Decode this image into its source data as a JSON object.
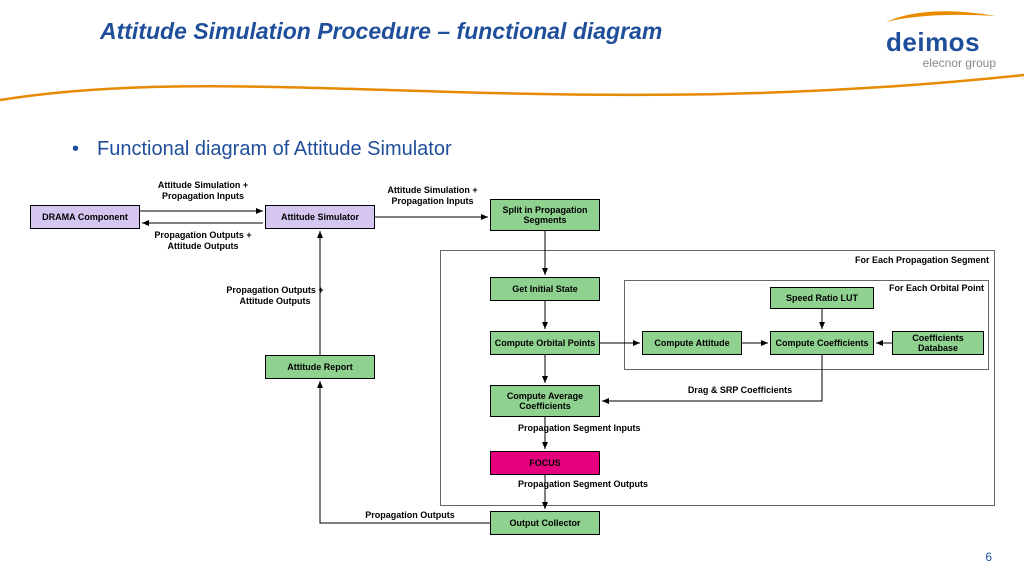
{
  "title": "Attitude Simulation Procedure – functional diagram",
  "logo": {
    "name": "deimos",
    "sub": "elecnor group"
  },
  "bullet": "Functional diagram of Attitude Simulator",
  "page": "6",
  "labels": {
    "l_attSimPropInputs_left": "Attitude Simulation + Propagation Inputs",
    "l_propOut_attOut_left": "Propagation Outputs + Attitude Outputs",
    "l_attSimPropInputs_mid": "Attitude Simulation + Propagation Inputs",
    "l_propOut_attOut_vert": "Propagation Outputs + Attitude Outputs",
    "l_forEachSeg": "For Each Propagation Segment",
    "l_forEachOrb": "For Each Orbital Point",
    "l_dragSrp": "Drag & SRP Coefficients",
    "l_propSegInputs": "Propagation Segment Inputs",
    "l_propSegOutputs": "Propagation Segment Outputs",
    "l_propOutputs": "Propagation Outputs"
  },
  "nodes": {
    "drama": "DRAMA Component",
    "attSim": "Attitude Simulator",
    "split": "Split in Propagation Segments",
    "getInit": "Get Initial State",
    "compOrb": "Compute Orbital Points",
    "compAtt": "Compute Attitude",
    "compCoef": "Compute Coefficients",
    "coefDb": "Coefficients Database",
    "speedLut": "Speed Ratio LUT",
    "compAvg": "Compute Average Coefficients",
    "focus": "FOCUS",
    "outColl": "Output Collector",
    "attRep": "Attitude Report"
  }
}
